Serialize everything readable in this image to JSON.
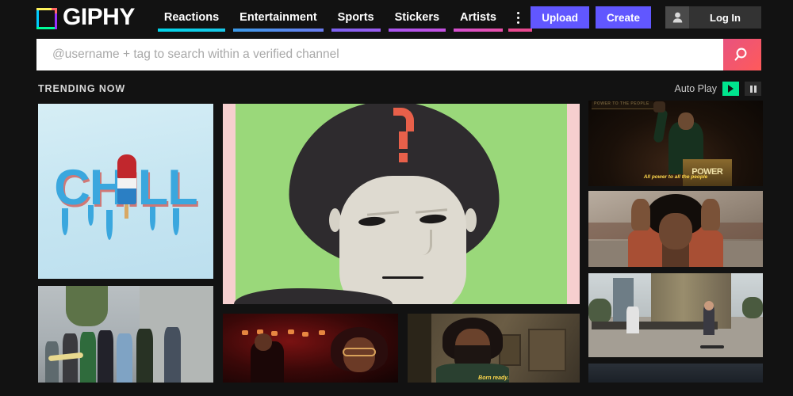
{
  "brand": {
    "name": "GIPHY",
    "logo_icon": "giphy-logo-icon",
    "logo_colors": [
      "#00ccff",
      "#00ff99",
      "#9933ff",
      "#fff35c",
      "#ff6666"
    ]
  },
  "nav": {
    "items": [
      {
        "label": "Reactions",
        "bar_color_from": "#00d4e8",
        "bar_color_to": "#18c8e8"
      },
      {
        "label": "Entertainment",
        "bar_color_from": "#3b9ae8",
        "bar_color_to": "#6a7cf0"
      },
      {
        "label": "Sports",
        "bar_color_from": "#7b62f0",
        "bar_color_to": "#9a5cf0"
      },
      {
        "label": "Stickers",
        "bar_color_from": "#a855f0",
        "bar_color_to": "#c44fe0"
      },
      {
        "label": "Artists",
        "bar_color_from": "#d44fd0",
        "bar_color_to": "#e84fa8"
      }
    ],
    "more_icon": "more-vertical-icon",
    "more_bar_color": "#e8488f"
  },
  "header_actions": {
    "upload_label": "Upload",
    "create_label": "Create",
    "login_label": "Log In",
    "avatar_icon": "user-avatar-icon",
    "button_color": "#6157ff"
  },
  "search": {
    "placeholder": "@username + tag to search within a verified channel",
    "value": "",
    "button_icon": "search-icon",
    "button_color": "#f4576b"
  },
  "trending": {
    "title": "TRENDING NOW",
    "autoplay_label": "Auto Play",
    "play_icon": "play-icon",
    "pause_icon": "pause-icon",
    "play_active_color": "#00e58e"
  },
  "tiles": {
    "chill": {
      "name": "chill-gif",
      "text": "CHILL",
      "alt": "Dripping blue CHILL letters with popsicle on ice background"
    },
    "face": {
      "name": "question-face-gif",
      "alt": "Illustrated face with dark hair and red question mark on green background"
    },
    "podium": {
      "name": "podium-speech-gif",
      "subtitle": "All power to all the people",
      "banner": "POWER TO THE PEOPLE",
      "sign": "POWER",
      "alt": "Man raising fist at a podium in dark hall"
    },
    "afro": {
      "name": "afro-hands-gif",
      "alt": "Man with afro raising hands in rust jacket"
    },
    "skate": {
      "name": "skatepark-gif",
      "alt": "Skateboarders riding at an urban skate park"
    },
    "girls": {
      "name": "street-group-gif",
      "alt": "Group of young women walking on a city street with skateboard"
    },
    "red": {
      "name": "red-bar-gif",
      "alt": "Woman in glasses in a red-lit room"
    },
    "born": {
      "name": "born-ready-gif",
      "subtitle": "Born ready.",
      "alt": "Man with afro and beard indoors"
    },
    "strip": {
      "name": "next-gif-preview",
      "alt": "Partially visible next gif"
    }
  }
}
